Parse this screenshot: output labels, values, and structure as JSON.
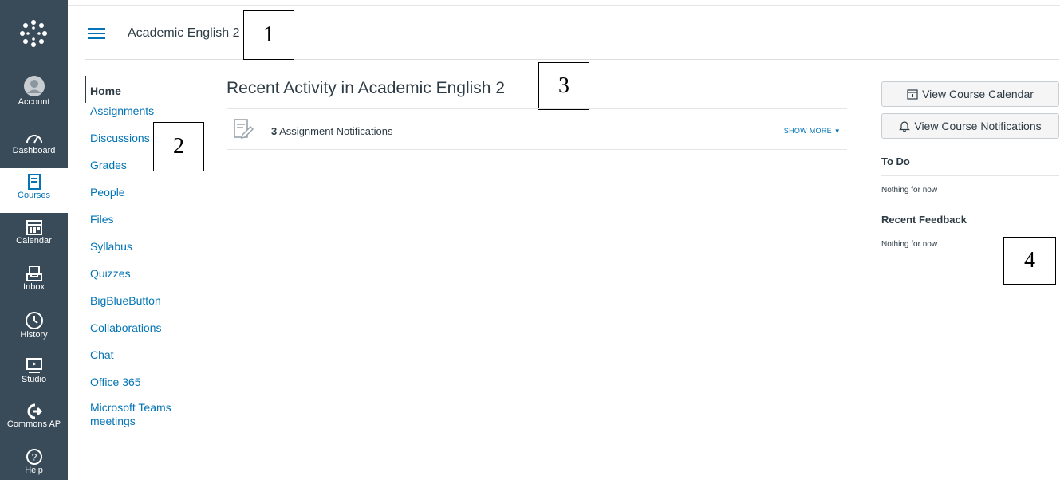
{
  "global_nav": {
    "items": [
      {
        "label": "Account",
        "icon": "account-icon"
      },
      {
        "label": "Dashboard",
        "icon": "dashboard-icon"
      },
      {
        "label": "Courses",
        "icon": "courses-icon",
        "active": true
      },
      {
        "label": "Calendar",
        "icon": "calendar-icon"
      },
      {
        "label": "Inbox",
        "icon": "inbox-icon"
      },
      {
        "label": "History",
        "icon": "history-icon"
      },
      {
        "label": "Studio",
        "icon": "studio-icon"
      },
      {
        "label": "Commons AP",
        "icon": "commons-icon"
      },
      {
        "label": "Help",
        "icon": "help-icon"
      }
    ]
  },
  "header": {
    "breadcrumb": "Academic English 2"
  },
  "annotations": [
    "1",
    "2",
    "3",
    "4"
  ],
  "course_nav": {
    "items": [
      {
        "label": "Home",
        "active": true
      },
      {
        "label": "Assignments"
      },
      {
        "label": "Discussions"
      },
      {
        "label": "Grades"
      },
      {
        "label": "People"
      },
      {
        "label": "Files"
      },
      {
        "label": "Syllabus"
      },
      {
        "label": "Quizzes"
      },
      {
        "label": "BigBlueButton"
      },
      {
        "label": "Collaborations"
      },
      {
        "label": "Chat"
      },
      {
        "label": "Office 365"
      },
      {
        "label": "Microsoft Teams meetings"
      }
    ]
  },
  "main": {
    "title": "Recent Activity in Academic English 2",
    "activity": {
      "count": "3",
      "label": "Assignment Notifications",
      "show_more": "SHOW MORE"
    }
  },
  "sidebar": {
    "calendar_button": "View Course Calendar",
    "notifications_button": "View Course Notifications",
    "todo_heading": "To Do",
    "todo_text": "Nothing for now",
    "feedback_heading": "Recent Feedback",
    "feedback_text": "Nothing for now"
  },
  "colors": {
    "nav_bg": "#394b58",
    "link": "#0374b5",
    "text": "#2d3b45"
  }
}
